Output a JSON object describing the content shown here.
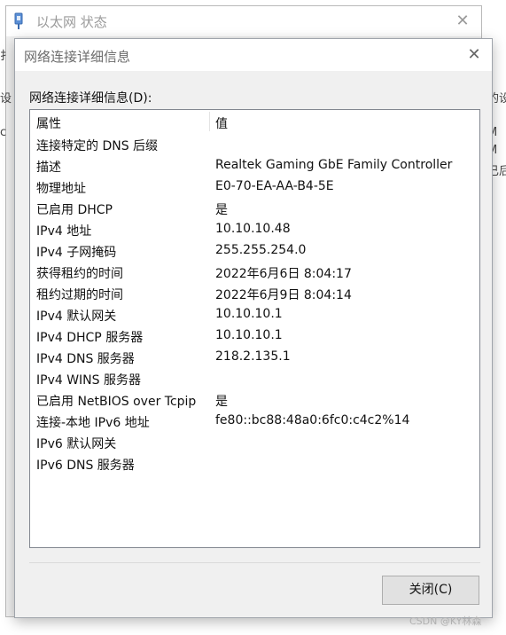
{
  "background_window": {
    "title": "以太网 状态",
    "close_label": "✕"
  },
  "right_fragments": [
    "M",
    "M",
    "已后",
    "的设"
  ],
  "left_fragments": [
    "扌",
    "设",
    "c"
  ],
  "dialog": {
    "title": "网络连接详细信息",
    "close_label": "✕",
    "group_label": "网络连接详细信息(D):",
    "columns": {
      "property": "属性",
      "value": "值"
    },
    "rows": [
      {
        "property": "连接特定的 DNS 后缀",
        "value": ""
      },
      {
        "property": "描述",
        "value": "Realtek Gaming GbE Family Controller"
      },
      {
        "property": "物理地址",
        "value": "E0-70-EA-AA-B4-5E"
      },
      {
        "property": "已启用 DHCP",
        "value": "是"
      },
      {
        "property": "IPv4 地址",
        "value": "10.10.10.48"
      },
      {
        "property": "IPv4 子网掩码",
        "value": "255.255.254.0"
      },
      {
        "property": "获得租约的时间",
        "value": "2022年6月6日 8:04:17"
      },
      {
        "property": "租约过期的时间",
        "value": "2022年6月9日 8:04:14"
      },
      {
        "property": "IPv4 默认网关",
        "value": "10.10.10.1"
      },
      {
        "property": "IPv4 DHCP 服务器",
        "value": "10.10.10.1"
      },
      {
        "property": "IPv4 DNS 服务器",
        "value": "218.2.135.1"
      },
      {
        "property": "IPv4 WINS 服务器",
        "value": ""
      },
      {
        "property": "已启用 NetBIOS over Tcpip",
        "value": "是"
      },
      {
        "property": "连接-本地 IPv6 地址",
        "value": "fe80::bc88:48a0:6fc0:c4c2%14"
      },
      {
        "property": "IPv6 默认网关",
        "value": ""
      },
      {
        "property": "IPv6 DNS 服务器",
        "value": ""
      }
    ],
    "close_button_label": "关闭(C)"
  },
  "watermark": "CSDN @KY林森"
}
